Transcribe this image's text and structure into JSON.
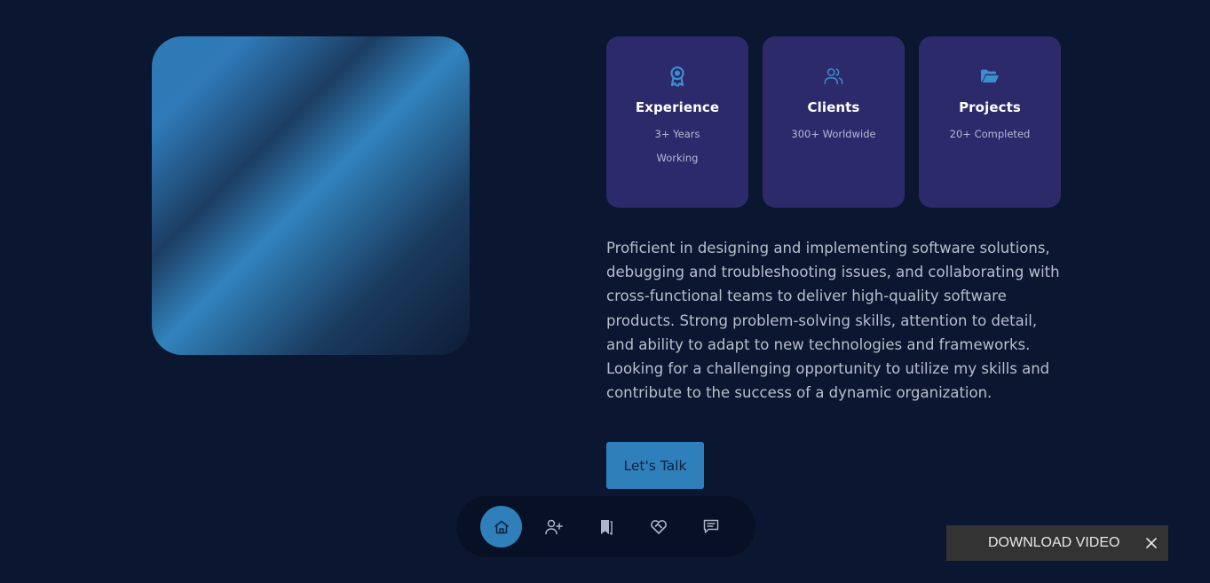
{
  "colors": {
    "background": "#0b1730",
    "card": "#2c2a6b",
    "accent": "#2f7fba",
    "nav_background": "#071024",
    "download_bar": "#333333"
  },
  "cards": [
    {
      "icon": "award-icon",
      "title": "Experience",
      "subtitle": "3+ Years Working"
    },
    {
      "icon": "users-icon",
      "title": "Clients",
      "subtitle": "300+ Worldwide"
    },
    {
      "icon": "folder-open-icon",
      "title": "Projects",
      "subtitle": "20+ Completed"
    }
  ],
  "bio": "Proficient in designing and implementing software solutions, debugging and troubleshooting issues, and collaborating with cross-functional teams to deliver high-quality software products. Strong problem-solving skills, attention to detail, and ability to adapt to new technologies and frameworks. Looking for a challenging opportunity to utilize my skills and contribute to the success of a dynamic organization.",
  "cta_label": "Let's Talk",
  "nav": [
    {
      "icon": "home-icon",
      "active": true
    },
    {
      "icon": "user-plus-icon",
      "active": false
    },
    {
      "icon": "bookmarks-icon",
      "active": false
    },
    {
      "icon": "handshake-heart-icon",
      "active": false
    },
    {
      "icon": "message-icon",
      "active": false
    }
  ],
  "download": {
    "label": "DOWNLOAD VIDEO",
    "close_icon": "close-icon"
  }
}
